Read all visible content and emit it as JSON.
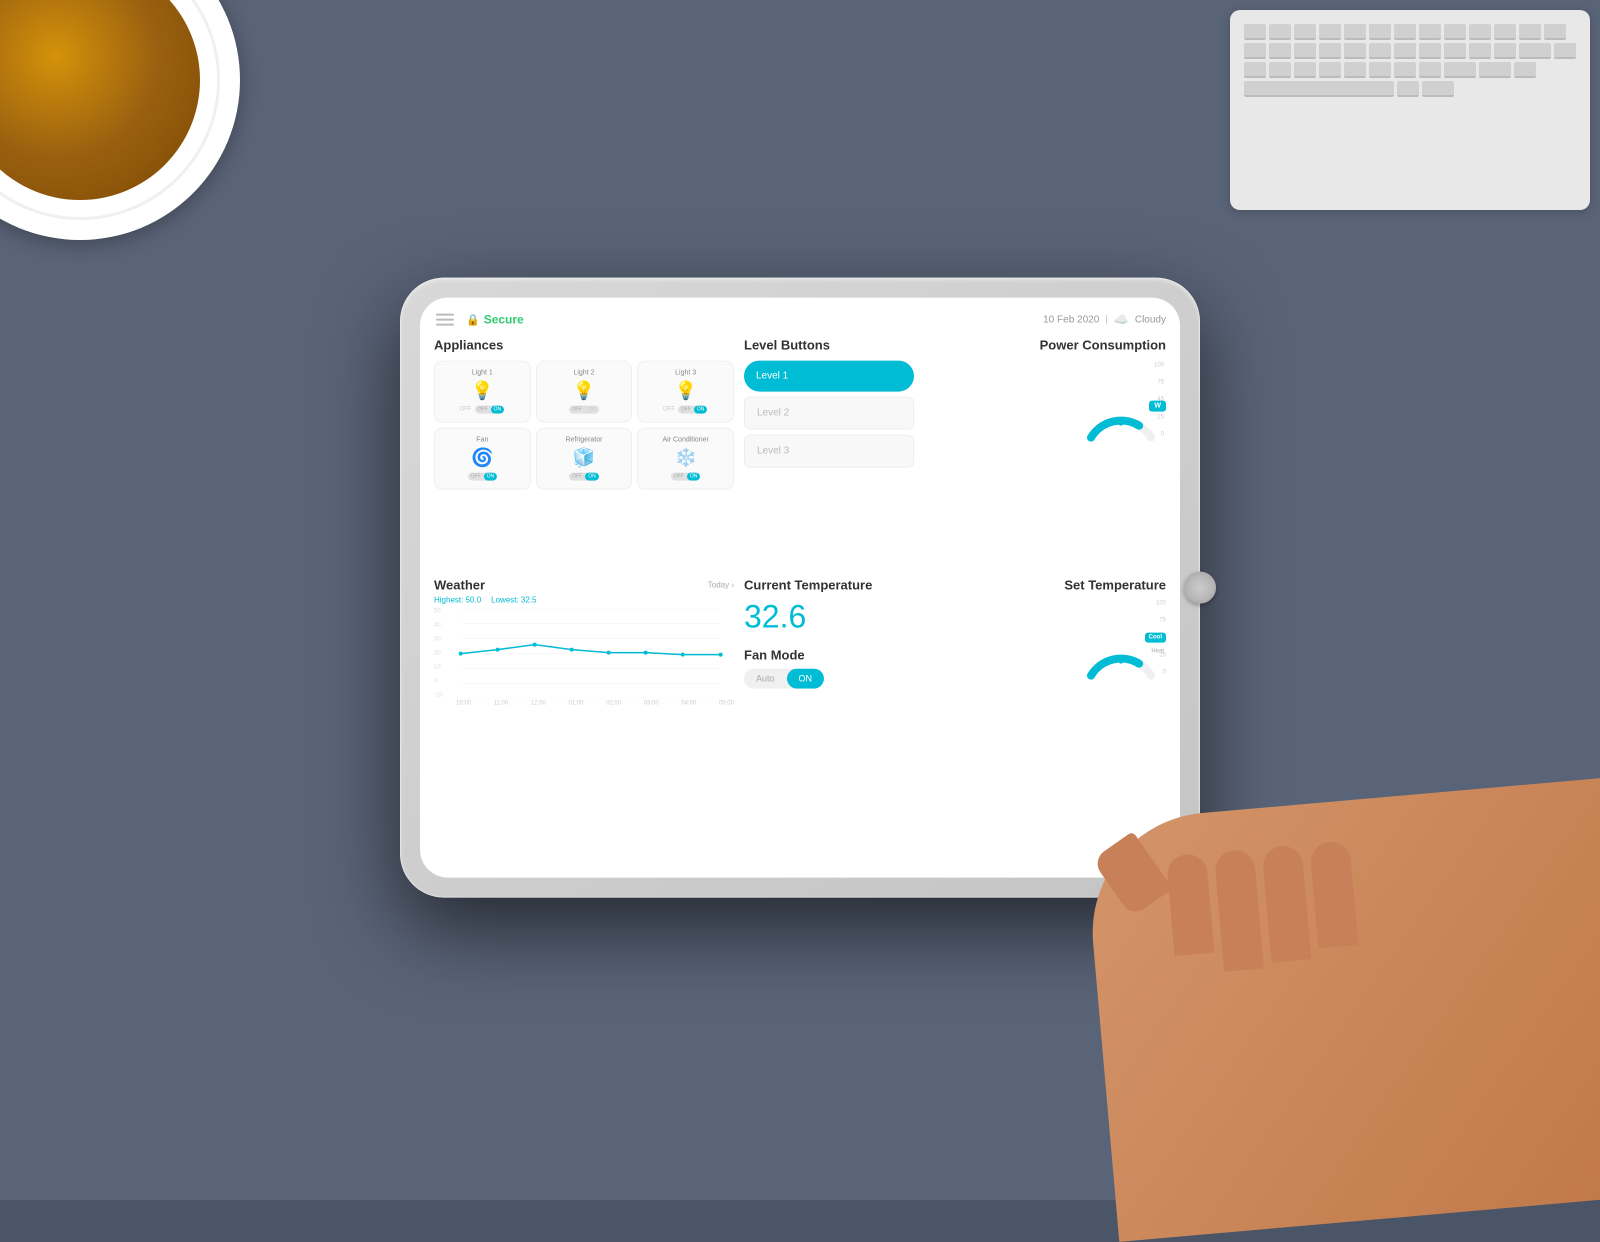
{
  "desk": {
    "bg_color": "#5a6478"
  },
  "header": {
    "menu_label": "menu",
    "secure_label": "Secure",
    "date_label": "10 Feb 2020",
    "weather_label": "Cloudy"
  },
  "appliances": {
    "section_title": "Appliances",
    "items": [
      {
        "name": "Light 1",
        "icon": "💡",
        "state": "on"
      },
      {
        "name": "Light 2",
        "icon": "💡",
        "state": "off"
      },
      {
        "name": "Light 3",
        "icon": "💡",
        "state": "on"
      },
      {
        "name": "Fan",
        "icon": "🌀",
        "state": "on"
      },
      {
        "name": "Refrigerator",
        "icon": "🧊",
        "state": "on"
      },
      {
        "name": "Air Conditioner",
        "icon": "❄️",
        "state": "on"
      }
    ]
  },
  "level_buttons": {
    "section_title": "Level Buttons",
    "levels": [
      {
        "label": "Level 1",
        "active": true
      },
      {
        "label": "Level 2",
        "active": false
      },
      {
        "label": "Level 3",
        "active": false
      }
    ]
  },
  "power": {
    "section_title": "Power Consumption",
    "gauge_labels": [
      "100",
      "75",
      "45",
      "25",
      "0"
    ],
    "badge": "W",
    "value": 45
  },
  "weather": {
    "section_title": "Weather",
    "highest_label": "Highest: 50.0",
    "lowest_label": "Lowest: 32.5",
    "period_label": "Today ›",
    "y_labels": [
      "50",
      "40",
      "30",
      "20",
      "10",
      "0",
      "-10"
    ],
    "x_labels": [
      "10:00",
      "11:00",
      "12:00",
      "01:00",
      "02:00",
      "03:00",
      "04:00",
      "05:00"
    ],
    "chart_points": [
      {
        "x": 0,
        "y": 20
      },
      {
        "x": 1,
        "y": 22
      },
      {
        "x": 2,
        "y": 24
      },
      {
        "x": 3,
        "y": 22
      },
      {
        "x": 4,
        "y": 21
      },
      {
        "x": 5,
        "y": 21
      },
      {
        "x": 6,
        "y": 20
      },
      {
        "x": 7,
        "y": 20
      }
    ]
  },
  "current_temp": {
    "section_title": "Current Temperature",
    "value": "32.6"
  },
  "fan_mode": {
    "title": "Fan Mode",
    "options": [
      "Auto",
      "ON"
    ],
    "active": "ON"
  },
  "set_temp": {
    "section_title": "Set Temperature",
    "gauge_labels": [
      "100",
      "75",
      "50",
      "25",
      "0"
    ],
    "cool_label": "Cool",
    "heat_label": "Heat",
    "value": 50
  }
}
